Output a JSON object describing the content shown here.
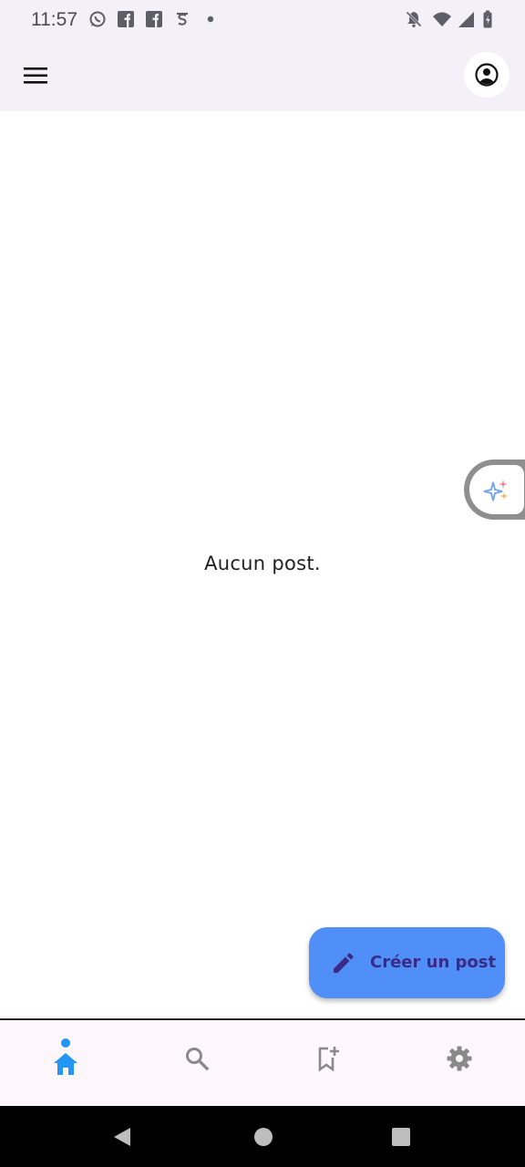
{
  "status_bar": {
    "time": "11:57",
    "left_icons": [
      "whatsapp-icon",
      "facebook-icon",
      "facebook-icon",
      "app-notification-icon",
      "dot-icon"
    ],
    "right_icons": [
      "notifications-off-icon",
      "wifi-icon",
      "signal-icon",
      "battery-icon"
    ]
  },
  "app_bar": {
    "menu_icon": "hamburger-menu-icon",
    "avatar_icon": "account-circle-icon"
  },
  "main": {
    "empty_message": "Aucun post."
  },
  "fab": {
    "label": "Créer un post",
    "icon": "pencil-icon",
    "color": "#4f8ff7"
  },
  "bottom_nav": {
    "items": [
      {
        "icon": "home-icon",
        "active": true
      },
      {
        "icon": "search-icon",
        "active": false
      },
      {
        "icon": "bookmark-add-icon",
        "active": false
      },
      {
        "icon": "settings-icon",
        "active": false
      }
    ],
    "active_color": "#2196f3",
    "inactive_color": "#8a8a8a"
  },
  "system_nav": {
    "buttons": [
      "back-icon",
      "home-circle-icon",
      "recents-icon"
    ]
  }
}
